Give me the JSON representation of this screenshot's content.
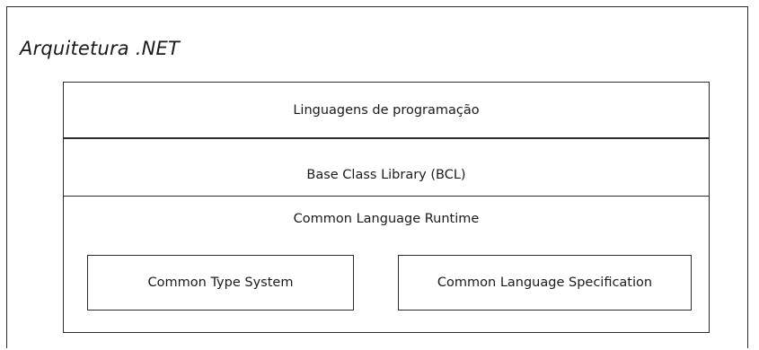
{
  "title": "Arquitetura .NET",
  "layers": {
    "languages": "Linguagens de programação",
    "bcl": "Base Class Library (BCL)",
    "clr": {
      "label": "Common Language Runtime",
      "components": {
        "cts": "Common Type System",
        "cls": "Common Language Specification"
      }
    }
  }
}
